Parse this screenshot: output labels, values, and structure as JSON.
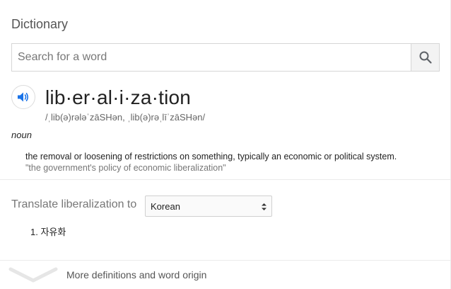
{
  "panel": {
    "title": "Dictionary"
  },
  "search": {
    "placeholder": "Search for a word",
    "value": "",
    "button_icon": "search-icon"
  },
  "entry": {
    "speaker_icon": "speaker-icon",
    "headword": "lib·er·al·i·za·tion",
    "phonetic": "/ˌlib(ə)rələˈzāSHən, ˌlib(ə)rəˌlīˈzāSHən/",
    "part_of_speech": "noun",
    "definition": "the removal or loosening of restrictions on something, typically an economic or political system.",
    "example": "\"the government's policy of economic liberalization\""
  },
  "translate": {
    "label": "Translate liberalization to",
    "selected_language": "Korean",
    "results": [
      "1. 자유화"
    ]
  },
  "footer": {
    "more_label": "More definitions and word origin",
    "chevron_icon": "chevron-down-icon"
  },
  "colors": {
    "speaker_blue": "#1a73e8",
    "muted_text": "#777777"
  }
}
